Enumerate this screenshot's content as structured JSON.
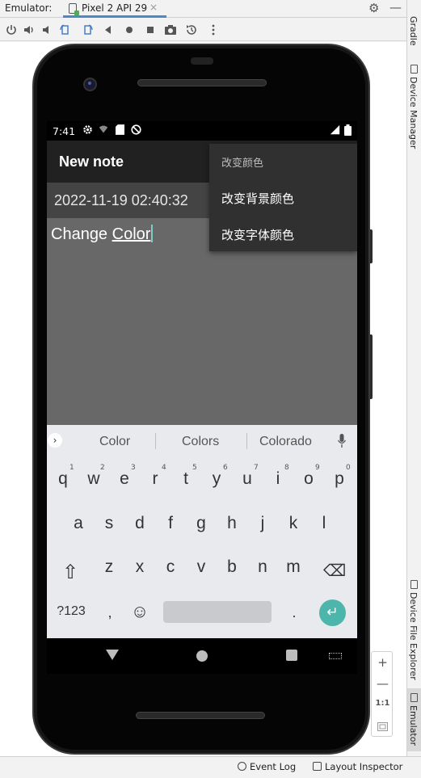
{
  "ide": {
    "emulator_label": "Emulator:",
    "device_tab": "Pixel 2 API 29",
    "tab_close": "×",
    "gear_icon": "⚙",
    "minimize_icon": "—"
  },
  "right_tools": {
    "gradle": "Gradle",
    "device_manager": "Device Manager",
    "device_file_explorer": "Device File Explorer",
    "emulator": "Emulator"
  },
  "bottom_bar": {
    "event_log": "Event Log",
    "layout_inspector": "Layout Inspector"
  },
  "zoom": {
    "zoom_in": "+",
    "zoom_out": "—",
    "one_to_one": "1:1"
  },
  "status_bar": {
    "time": "7:41"
  },
  "app": {
    "title": "New note",
    "date": "2022-11-19 02:40:32",
    "note_text_plain": "Change ",
    "note_text_composing": "Color"
  },
  "menu": {
    "header": "改变颜色",
    "items": [
      "改变背景颜色",
      "改变字体颜色"
    ]
  },
  "keyboard": {
    "suggestions": [
      "Color",
      "Colors",
      "Colorado"
    ],
    "row1": [
      {
        "k": "q",
        "n": "1"
      },
      {
        "k": "w",
        "n": "2"
      },
      {
        "k": "e",
        "n": "3"
      },
      {
        "k": "r",
        "n": "4"
      },
      {
        "k": "t",
        "n": "5"
      },
      {
        "k": "y",
        "n": "6"
      },
      {
        "k": "u",
        "n": "7"
      },
      {
        "k": "i",
        "n": "8"
      },
      {
        "k": "o",
        "n": "9"
      },
      {
        "k": "p",
        "n": "0"
      }
    ],
    "row2": [
      "a",
      "s",
      "d",
      "f",
      "g",
      "h",
      "j",
      "k",
      "l"
    ],
    "row3": [
      "z",
      "x",
      "c",
      "v",
      "b",
      "n",
      "m"
    ],
    "sym": "?123",
    "comma": ",",
    "period": ".",
    "enter_icon": "↵",
    "shift_icon": "⇧",
    "backspace_icon": "⌫",
    "emoji_icon": "☺"
  },
  "colors": {
    "accent": "#4db6ac",
    "appbar": "#212121",
    "menu": "#303030",
    "content": "#686868"
  }
}
